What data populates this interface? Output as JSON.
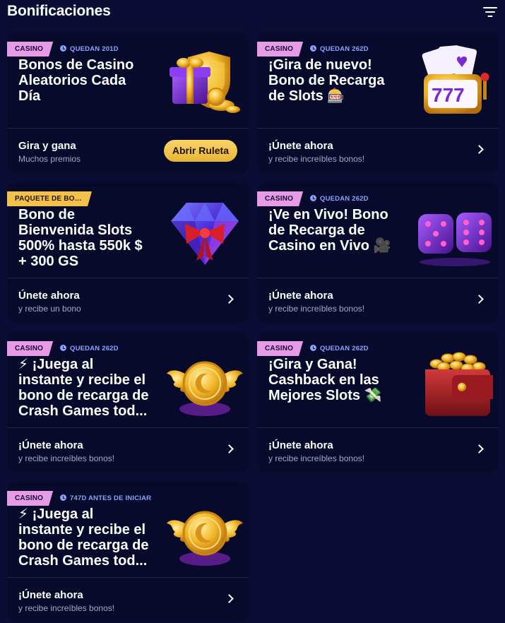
{
  "header": {
    "title": "Bonificaciones",
    "filter_icon": "filter-icon"
  },
  "cards": [
    {
      "badge": "CASINO",
      "timer": "QUEDAN 201D",
      "title": "Bonos de Casino\nAleatorios Cada\nDía",
      "art": "gift-shield-coins",
      "cta_title": "Gira y gana",
      "cta_sub": "Muchos premios",
      "button": "Abrir Ruleta"
    },
    {
      "badge": "CASINO",
      "timer": "QUEDAN 262D",
      "title": "¡Gira de nuevo!\nBono de Recarga\nde Slots 🎰",
      "art": "slot-machine-777",
      "cta_title": "¡Únete ahora",
      "cta_sub": "y recibe increíbles bonos!"
    },
    {
      "badge": "PAQUETE DE BONI...",
      "timer": "",
      "title": "Bono de\nBienvenida Slots\n500% hasta 550k $\n+ 300 GS",
      "art": "diamond-bow",
      "cta_title": "Únete ahora",
      "cta_sub": "y recibe un bono"
    },
    {
      "badge": "CASINO",
      "timer": "QUEDAN 262D",
      "title": "¡Ve en Vivo! Bono\nde Recarga de\nCasino en Vivo 🎥",
      "art": "purple-dice",
      "cta_title": "¡Únete ahora",
      "cta_sub": "y recibe increíbles bonos!"
    },
    {
      "badge": "CASINO",
      "timer": "QUEDAN 262D",
      "title": "⚡ ¡Juega al\ninstante y recibe el\nbono de recarga de\nCrash Games tod...",
      "art": "winged-coin",
      "cta_title": "¡Únete ahora",
      "cta_sub": "y recibe increíbles bonos!"
    },
    {
      "badge": "CASINO",
      "timer": "QUEDAN 262D",
      "title": "¡Gira y Gana!\nCashback en las\nMejores Slots 💸",
      "art": "coin-wallet",
      "cta_title": "¡Únete ahora",
      "cta_sub": "y recibe increíbles bonos!"
    },
    {
      "badge": "CASINO",
      "timer": "747D ANTES DE INICIAR",
      "title": "⚡ ¡Juega al\ninstante y recibe el\nbono de recarga de\nCrash Games tod...",
      "art": "winged-coin",
      "cta_title": "¡Únete ahora",
      "cta_sub": "y recibe increíbles bonos!"
    }
  ],
  "colors": {
    "background": "#0b0d35",
    "card": "#080a2c",
    "badge_casino": "#e69be6",
    "badge_package": "#f2c14a",
    "timer": "#8aa3ff",
    "button_gold": "#f2c14a"
  }
}
